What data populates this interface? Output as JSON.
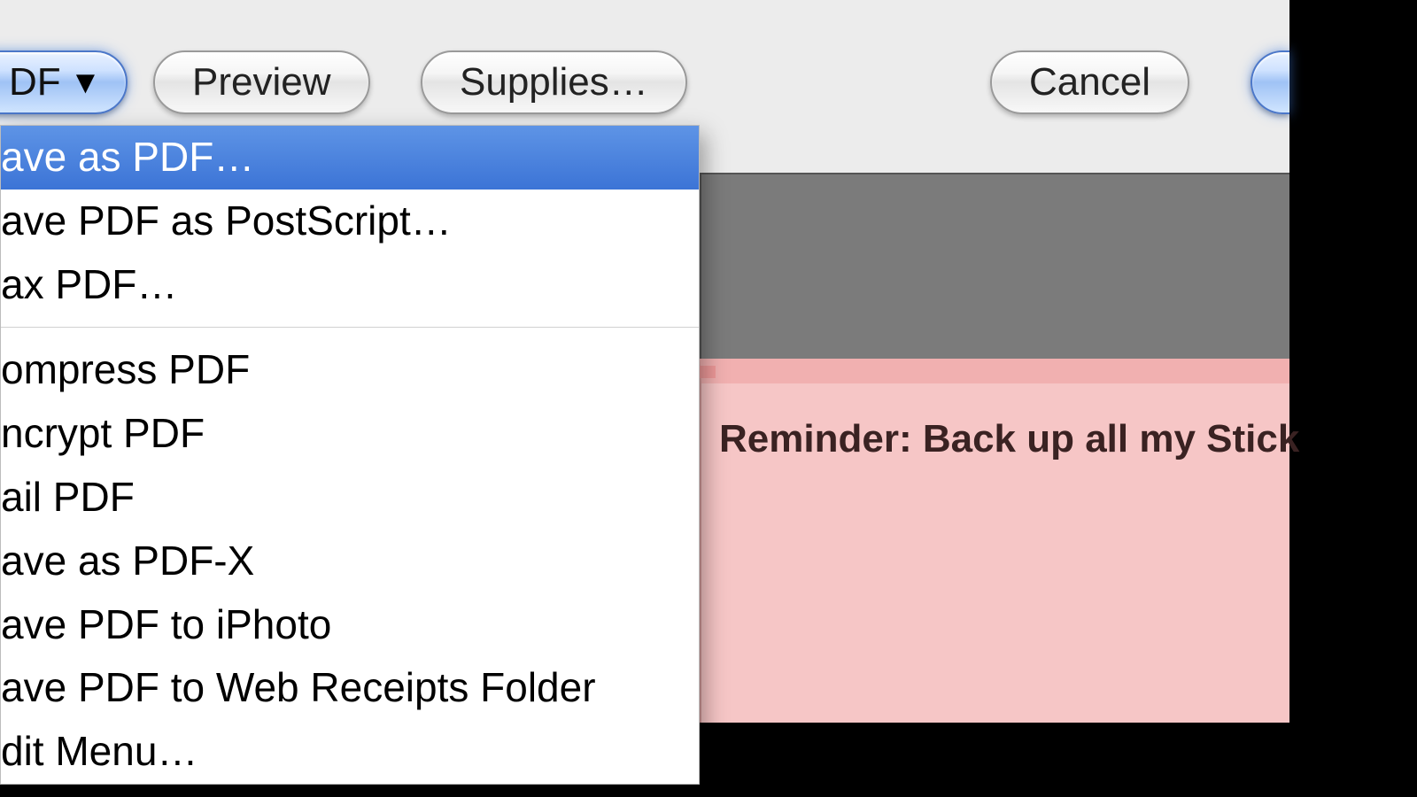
{
  "toolbar": {
    "pdf_button": {
      "label_fragment": "DF",
      "glyph": "▼"
    },
    "preview_label": "Preview",
    "supplies_label": "Supplies…",
    "cancel_label": "Cancel"
  },
  "menu": {
    "group1": [
      {
        "label": "ave as PDF…",
        "selected": true
      },
      {
        "label": "ave PDF as PostScript…",
        "selected": false
      },
      {
        "label": "ax PDF…",
        "selected": false
      }
    ],
    "group2": [
      {
        "label": "ompress PDF"
      },
      {
        "label": "ncrypt PDF"
      },
      {
        "label": "ail PDF"
      },
      {
        "label": "ave as PDF-X"
      },
      {
        "label": "ave PDF to iPhoto"
      },
      {
        "label": "ave PDF to Web Receipts Folder"
      },
      {
        "label": "dit Menu…"
      }
    ]
  },
  "sticky": {
    "text": "Reminder: Back up all my Stick"
  }
}
